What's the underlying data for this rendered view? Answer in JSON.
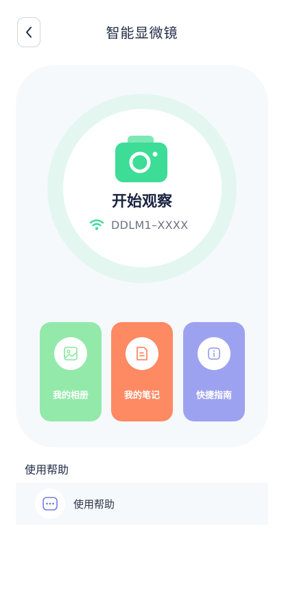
{
  "header": {
    "title": "智能显微镜"
  },
  "main": {
    "start_label": "开始观察",
    "device_name": "DDLM1–XXXX",
    "tiles": [
      {
        "label": "我的相册",
        "icon": "image-icon",
        "color": "#93e9a9"
      },
      {
        "label": "我的笔记",
        "icon": "note-icon",
        "color": "#fe8a63"
      },
      {
        "label": "快捷指南",
        "icon": "info-icon",
        "color": "#9da2f0"
      }
    ]
  },
  "help": {
    "section_title": "使用帮助",
    "item_label": "使用帮助"
  },
  "colors": {
    "accent_green": "#3ddc97",
    "ring": "#e3f7f0",
    "card_bg": "#f6f9fc",
    "text_dark": "#1f2a44"
  }
}
